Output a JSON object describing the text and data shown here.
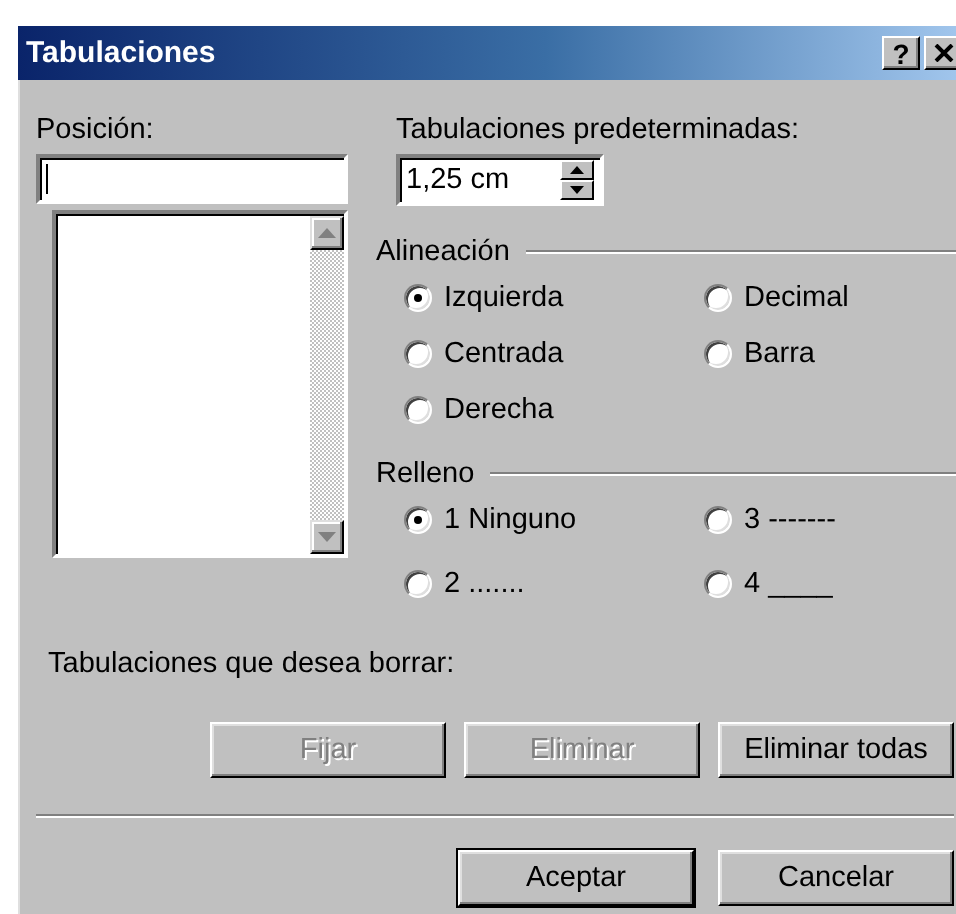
{
  "window": {
    "title": "Tabulaciones",
    "help_button": "?"
  },
  "position": {
    "label": "Posición:"
  },
  "default_stops": {
    "label": "Tabulaciones predeterminadas:",
    "value": "1,25 cm"
  },
  "alignment": {
    "title": "Alineación",
    "options": [
      {
        "label": "Izquierda",
        "selected": true
      },
      {
        "label": "Decimal",
        "selected": false
      },
      {
        "label": "Centrada",
        "selected": false
      },
      {
        "label": "Barra",
        "selected": false
      },
      {
        "label": "Derecha",
        "selected": false
      }
    ]
  },
  "leader": {
    "title": "Relleno",
    "options": [
      {
        "label": "1 Ninguno",
        "selected": true
      },
      {
        "label": "3 -------",
        "selected": false
      },
      {
        "label": "2 .......",
        "selected": false
      },
      {
        "label": "4 ____",
        "selected": false
      }
    ]
  },
  "clear_label": "Tabulaciones que desea borrar:",
  "buttons": [
    {
      "label": "Fijar",
      "disabled": true
    },
    {
      "label": "Eliminar",
      "disabled": true
    },
    {
      "label": "Eliminar todas",
      "disabled": false
    }
  ],
  "footer_buttons": [
    {
      "label": "Aceptar",
      "default": true
    },
    {
      "label": "Cancelar",
      "default": false
    }
  ]
}
